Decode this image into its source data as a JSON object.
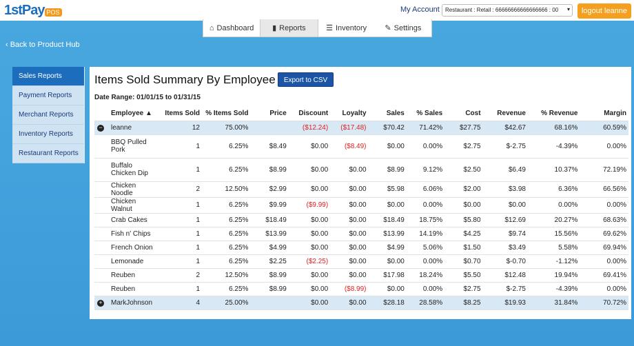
{
  "header": {
    "logo_text": "1stPay",
    "logo_badge": "POS",
    "my_account": "My Account",
    "store_select": "Restaurant : Retail : 66666666666666666 : 00",
    "logout": "logout leanne"
  },
  "nav": [
    {
      "icon": "home-icon",
      "glyph": "⌂",
      "label": "Dashboard"
    },
    {
      "icon": "bar-chart-icon",
      "glyph": "▮",
      "label": "Reports"
    },
    {
      "icon": "list-icon",
      "glyph": "☰",
      "label": "Inventory"
    },
    {
      "icon": "wrench-icon",
      "glyph": "✎",
      "label": "Settings"
    }
  ],
  "back_link": "‹ Back to Product Hub",
  "sidebar": [
    {
      "label": "Sales Reports"
    },
    {
      "label": "Payment Reports"
    },
    {
      "label": "Merchant Reports"
    },
    {
      "label": "Inventory Reports"
    },
    {
      "label": "Restaurant Reports"
    }
  ],
  "report": {
    "title": "Items Sold Summary By Employee",
    "export_label": "Export to CSV",
    "date_range": "Date Range: 01/01/15 to 01/31/15",
    "columns": [
      "Employee ▲",
      "Items Sold",
      "% Items Sold",
      "Price",
      "Discount",
      "Loyalty",
      "Sales",
      "% Sales",
      "Cost",
      "Revenue",
      "% Revenue",
      "Margin"
    ],
    "rows": [
      {
        "type": "group",
        "toggle": "−",
        "cells": [
          "leanne",
          "12",
          "75.00%",
          "",
          "($12.24)",
          "($17.48)",
          "$70.42",
          "71.42%",
          "$27.75",
          "$42.67",
          "68.16%",
          "60.59%"
        ]
      },
      {
        "type": "item",
        "tall": true,
        "cells": [
          "BBQ Pulled Pork",
          "1",
          "6.25%",
          "$8.49",
          "$0.00",
          "($8.49)",
          "$0.00",
          "0.00%",
          "$2.75",
          "$-2.75",
          "-4.39%",
          "0.00%"
        ]
      },
      {
        "type": "item",
        "tall": true,
        "cells": [
          "Buffalo Chicken Dip",
          "1",
          "6.25%",
          "$8.99",
          "$0.00",
          "$0.00",
          "$8.99",
          "9.12%",
          "$2.50",
          "$6.49",
          "10.37%",
          "72.19%"
        ]
      },
      {
        "type": "item",
        "cells": [
          "Chicken Noodle",
          "2",
          "12.50%",
          "$2.99",
          "$0.00",
          "$0.00",
          "$5.98",
          "6.06%",
          "$2.00",
          "$3.98",
          "6.36%",
          "66.56%"
        ]
      },
      {
        "type": "item",
        "cells": [
          "Chicken Walnut",
          "1",
          "6.25%",
          "$9.99",
          "($9.99)",
          "$0.00",
          "$0.00",
          "0.00%",
          "$0.00",
          "$0.00",
          "0.00%",
          "0.00%"
        ]
      },
      {
        "type": "item",
        "cells": [
          "Crab Cakes",
          "1",
          "6.25%",
          "$18.49",
          "$0.00",
          "$0.00",
          "$18.49",
          "18.75%",
          "$5.80",
          "$12.69",
          "20.27%",
          "68.63%"
        ]
      },
      {
        "type": "item",
        "cells": [
          "Fish n' Chips",
          "1",
          "6.25%",
          "$13.99",
          "$0.00",
          "$0.00",
          "$13.99",
          "14.19%",
          "$4.25",
          "$9.74",
          "15.56%",
          "69.62%"
        ]
      },
      {
        "type": "item",
        "cells": [
          "French Onion",
          "1",
          "6.25%",
          "$4.99",
          "$0.00",
          "$0.00",
          "$4.99",
          "5.06%",
          "$1.50",
          "$3.49",
          "5.58%",
          "69.94%"
        ]
      },
      {
        "type": "item",
        "cells": [
          "Lemonade",
          "1",
          "6.25%",
          "$2.25",
          "($2.25)",
          "$0.00",
          "$0.00",
          "0.00%",
          "$0.70",
          "$-0.70",
          "-1.12%",
          "0.00%"
        ]
      },
      {
        "type": "item",
        "cells": [
          "Reuben",
          "2",
          "12.50%",
          "$8.99",
          "$0.00",
          "$0.00",
          "$17.98",
          "18.24%",
          "$5.50",
          "$12.48",
          "19.94%",
          "69.41%"
        ]
      },
      {
        "type": "item",
        "cells": [
          "Reuben",
          "1",
          "6.25%",
          "$8.99",
          "$0.00",
          "($8.99)",
          "$0.00",
          "0.00%",
          "$2.75",
          "$-2.75",
          "-4.39%",
          "0.00%"
        ]
      },
      {
        "type": "group",
        "toggle": "+",
        "cells": [
          "MarkJohnson",
          "4",
          "25.00%",
          "",
          "$0.00",
          "$0.00",
          "$28.18",
          "28.58%",
          "$8.25",
          "$19.93",
          "31.84%",
          "70.72%"
        ]
      }
    ]
  }
}
